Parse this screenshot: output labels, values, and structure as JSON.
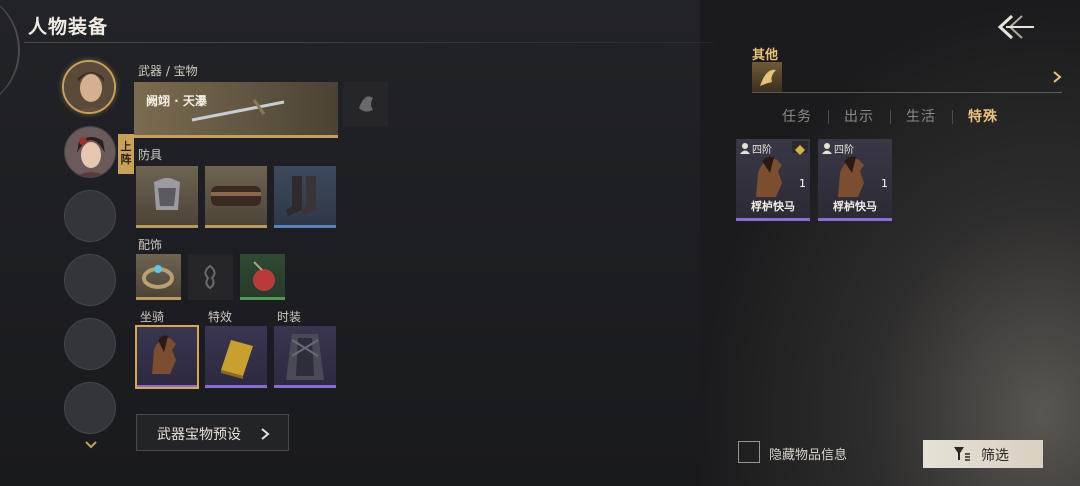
{
  "header": {
    "title": "人物装备"
  },
  "characters": {
    "onstage_label": "上阵"
  },
  "sections": {
    "weapon_label": "武器 / 宝物",
    "armor_label": "防具",
    "accessory_label": "配饰",
    "mount_label": "坐骑",
    "effect_label": "特效",
    "fashion_label": "时装"
  },
  "weapon": {
    "name": "阙翊 · 天瀑"
  },
  "preset_button": {
    "label": "武器宝物预设"
  },
  "other": {
    "label": "其他"
  },
  "tabs": [
    {
      "label": "任务"
    },
    {
      "label": "出示"
    },
    {
      "label": "生活"
    },
    {
      "label": "特殊"
    }
  ],
  "active_tab": "特殊",
  "items": [
    {
      "tier": "四阶",
      "count": "1",
      "name": "桴栌快马"
    },
    {
      "tier": "四阶",
      "count": "1",
      "name": "桴栌快马"
    }
  ],
  "hide_info": {
    "label": "隐藏物品信息",
    "checked": false
  },
  "filter_button": {
    "label": "筛选"
  },
  "colors": {
    "accent": "#e8c27a",
    "rare_purple": "#8c6cd6",
    "gold_border": "#c4a05a"
  }
}
